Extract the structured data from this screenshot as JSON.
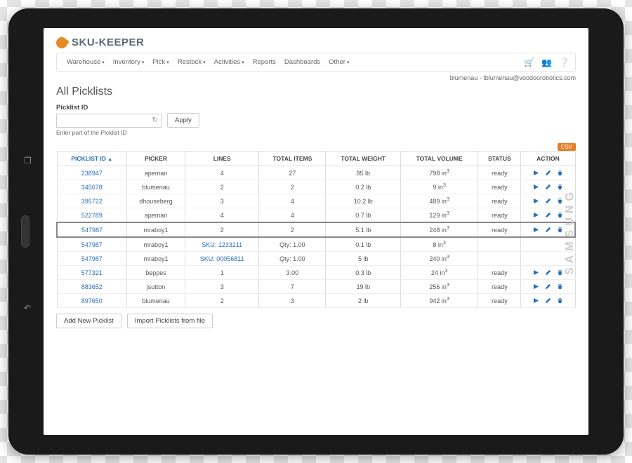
{
  "brand": "SKU-KEEPER",
  "nav": {
    "items": [
      "Warehouse",
      "Inventory",
      "Pick",
      "Restock",
      "Activities",
      "Reports",
      "Dashboards",
      "Other"
    ],
    "dropdowns": [
      true,
      true,
      true,
      true,
      true,
      false,
      false,
      true
    ]
  },
  "user_line": "blumenau - tblumenau@voodoorobotics.com",
  "page_title": "All Picklists",
  "filter": {
    "label": "Picklist ID",
    "apply": "Apply",
    "hint": "Enter part of the Picklist ID"
  },
  "csv_label": "CSV",
  "columns": [
    "PICKLIST ID",
    "PICKER",
    "LINES",
    "TOTAL ITEMS",
    "TOTAL WEIGHT",
    "TOTAL VOLUME",
    "STATUS",
    "ACTION"
  ],
  "vol_unit_html": "in³",
  "rows": [
    {
      "id": "238947",
      "picker": "apeman",
      "lines": "4",
      "items": "27",
      "weight": "85 lb",
      "vol": "798",
      "status": "ready",
      "actions": true
    },
    {
      "id": "345678",
      "picker": "blumenau",
      "lines": "2",
      "items": "2",
      "weight": "0.2 lb",
      "vol": "9",
      "status": "ready",
      "actions": true
    },
    {
      "id": "395722",
      "picker": "dhouseberg",
      "lines": "3",
      "items": "4",
      "weight": "10.2 lb",
      "vol": "489",
      "status": "ready",
      "actions": true
    },
    {
      "id": "522789",
      "picker": "apeman",
      "lines": "4",
      "items": "4",
      "weight": "0.7 lb",
      "vol": "129",
      "status": "ready",
      "actions": true
    },
    {
      "id": "547987",
      "picker": "mraboy1",
      "lines": "2",
      "items": "2",
      "weight": "5.1 lb",
      "vol": "248",
      "status": "ready",
      "actions": true,
      "selected": true
    },
    {
      "id": "547987",
      "picker": "mraboy1",
      "sku": "SKU: 1233211",
      "qty": "Qty: 1.00",
      "weight": "0.1 lb",
      "vol": "8",
      "detail": true
    },
    {
      "id": "547987",
      "picker": "mraboy1",
      "sku": "SKU: 00056811",
      "qty": "Qty: 1.00",
      "weight": "5 lb",
      "vol": "240",
      "detail": true
    },
    {
      "id": "577321",
      "picker": "beppes",
      "lines": "1",
      "items": "3.00",
      "weight": "0.3 lb",
      "vol": "24",
      "status": "ready",
      "actions": true
    },
    {
      "id": "883652",
      "picker": "jsutton",
      "lines": "3",
      "items": "7",
      "weight": "19 lb",
      "vol": "256",
      "status": "ready",
      "actions": true
    },
    {
      "id": "897650",
      "picker": "blumenau",
      "lines": "2",
      "items": "3",
      "weight": "2 lb",
      "vol": "942",
      "status": "ready",
      "actions": true
    }
  ],
  "footer": {
    "add": "Add New Picklist",
    "import": "Import Picklists from file"
  }
}
